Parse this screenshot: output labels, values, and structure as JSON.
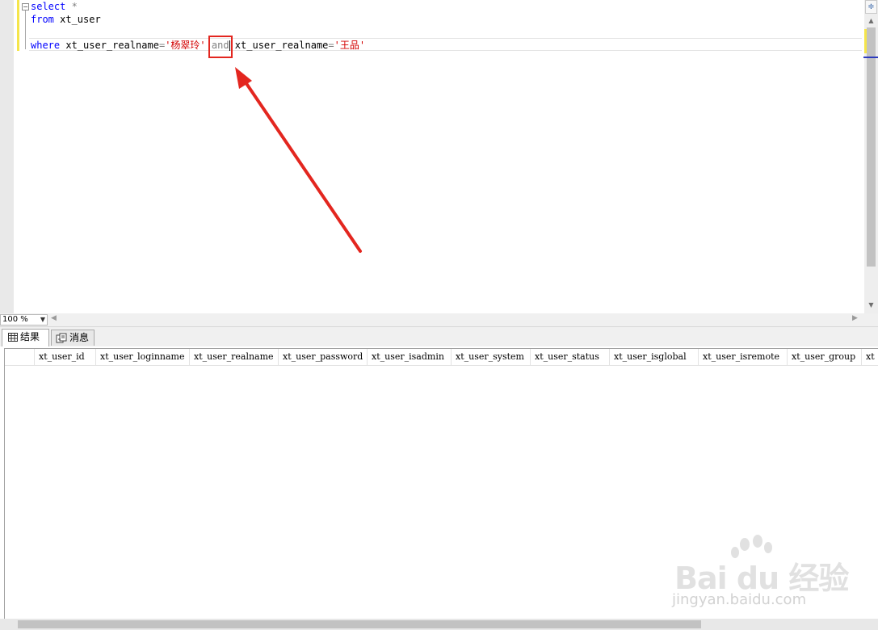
{
  "editor": {
    "lines": {
      "l1_kw": "select",
      "l1_rest": " *",
      "l2_kw": "from",
      "l2_rest": " xt_user",
      "l4_kw": "where",
      "l4_col1": " xt_user_realname",
      "l4_eq1": "=",
      "l4_str1": "'杨翠玲'",
      "l4_and": "and",
      "l4_col2": "xt_user_realname",
      "l4_eq2": "=",
      "l4_str2": "'王品'"
    },
    "fold_symbol": "−",
    "split_symbol": "≑"
  },
  "zoom": {
    "value": "100 %"
  },
  "tabs": {
    "results": "结果",
    "messages": "消息"
  },
  "grid": {
    "columns": [
      "xt_user_id",
      "xt_user_loginname",
      "xt_user_realname",
      "xt_user_password",
      "xt_user_isadmin",
      "xt_user_system",
      "xt_user_status",
      "xt_user_isglobal",
      "xt_user_isremote",
      "xt_user_group",
      "xt"
    ]
  },
  "watermark": {
    "brand": "Bai du 经验",
    "url": "jingyan.baidu.com"
  },
  "colors": {
    "keyword": "#0000ff",
    "string": "#d30000",
    "operator": "#808080",
    "annotation_red": "#e3261f",
    "change_bar": "#f5e54b"
  }
}
